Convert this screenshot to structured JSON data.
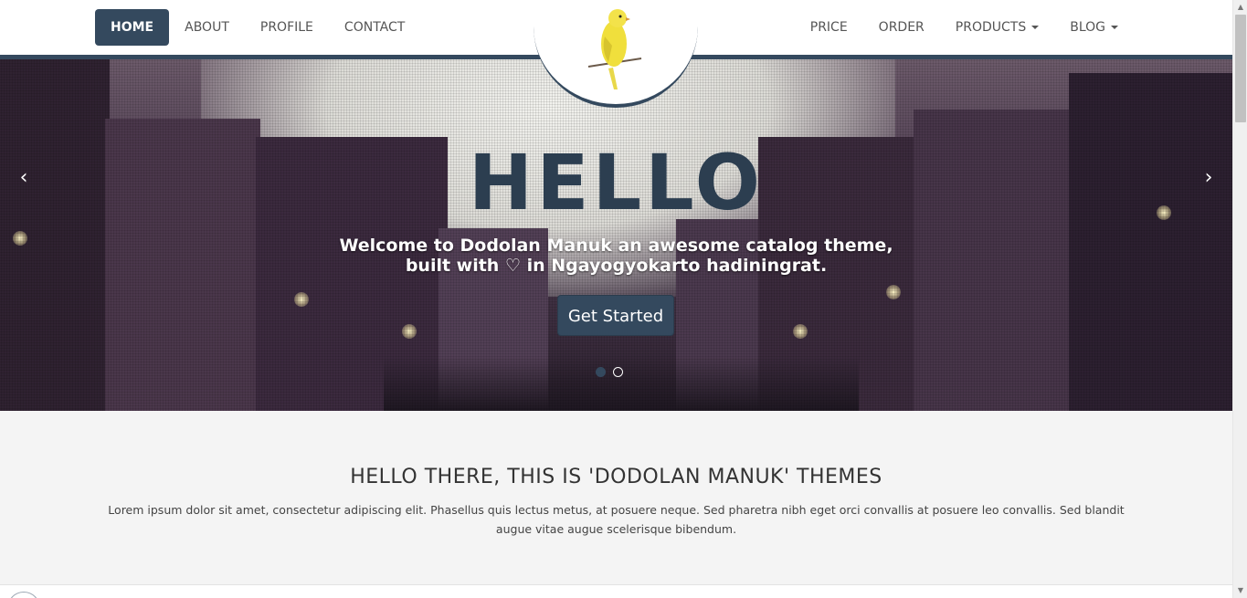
{
  "nav": {
    "left": [
      {
        "label": "HOME",
        "active": true
      },
      {
        "label": "ABOUT"
      },
      {
        "label": "PROFILE"
      },
      {
        "label": "CONTACT"
      }
    ],
    "right": [
      {
        "label": "PRICE"
      },
      {
        "label": "ORDER"
      },
      {
        "label": "PRODUCTS",
        "dropdown": true
      },
      {
        "label": "BLOG",
        "dropdown": true
      }
    ]
  },
  "logo": {
    "icon": "canary-bird-icon"
  },
  "hero": {
    "title": "HELLO",
    "subtitle_line1": "Welcome to Dodolan Manuk an awesome catalog theme,",
    "subtitle_line2_a": "built with ",
    "heart": "♡",
    "subtitle_line2_b": " in Ngayogyokarto hadiningrat.",
    "cta": "Get Started",
    "prev_glyph": "‹",
    "next_glyph": "›",
    "slide_count": 2,
    "active_slide": 1
  },
  "section": {
    "heading": "HELLO THERE, THIS IS 'DODOLAN MANUK' THEMES",
    "text": "Lorem ipsum dolor sit amet, consectetur adipiscing elit. Phasellus quis lectus metus, at posuere neque. Sed pharetra nibh eget orci convallis at posuere leo convallis. Sed blandit augue vitae augue scelerisque bibendum."
  },
  "colors": {
    "primary": "#34495e",
    "section_bg": "#f4f4f4"
  }
}
